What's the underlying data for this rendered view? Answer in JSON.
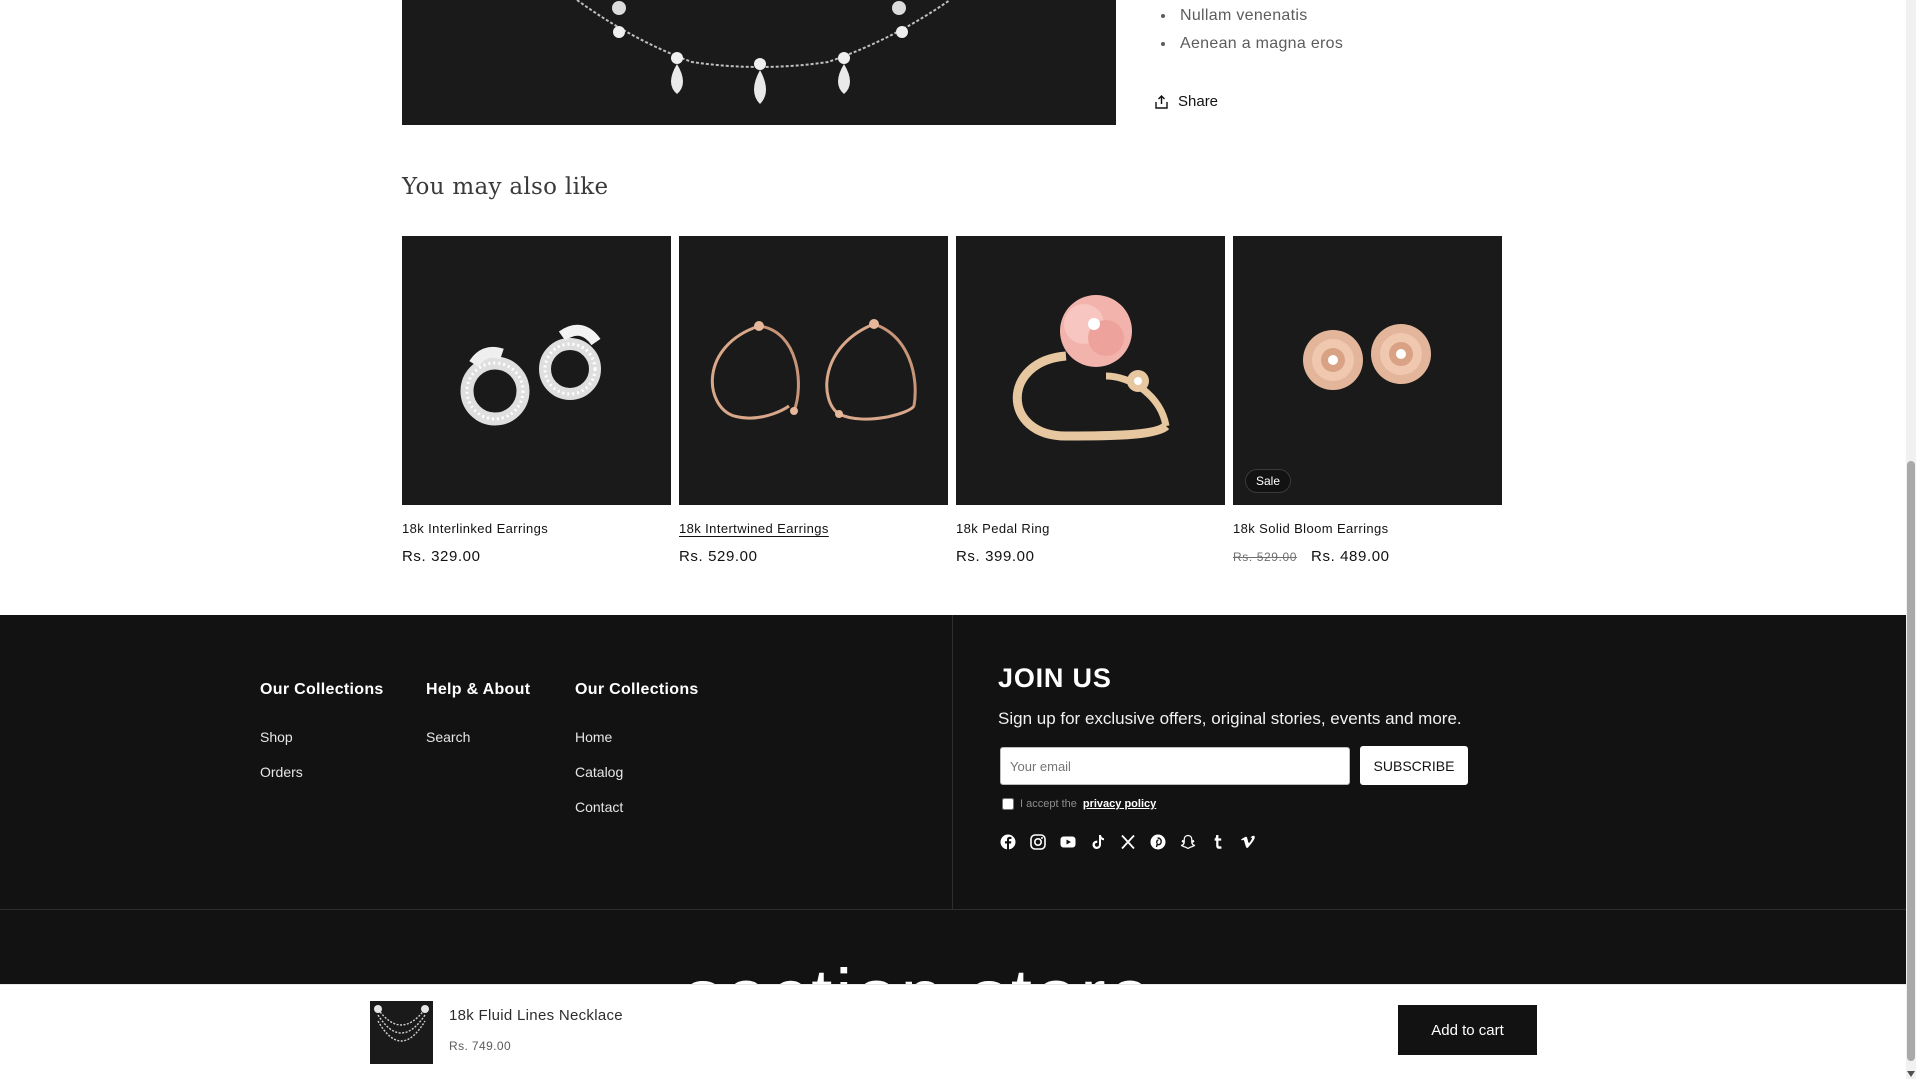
{
  "product": {
    "bullets": [
      "Nullam venenatis",
      "Aenean a magna eros"
    ],
    "share_label": "Share"
  },
  "related": {
    "title": "You may also like",
    "items": [
      {
        "title": "18k Interlinked Earrings",
        "price": "Rs. 329.00",
        "compare_price": "",
        "badge": ""
      },
      {
        "title": "18k Intertwined Earrings",
        "price": "Rs. 529.00",
        "compare_price": "",
        "badge": ""
      },
      {
        "title": "18k Pedal Ring",
        "price": "Rs. 399.00",
        "compare_price": "",
        "badge": ""
      },
      {
        "title": "18k Solid Bloom Earrings",
        "price": "Rs. 489.00",
        "compare_price": "Rs. 529.00",
        "badge": "Sale"
      }
    ]
  },
  "footer": {
    "columns": [
      {
        "heading": "Our Collections",
        "links": [
          "Shop",
          "Orders"
        ]
      },
      {
        "heading": "Help & About",
        "links": [
          "Search"
        ]
      },
      {
        "heading": "Our Collections",
        "links": [
          "Home",
          "Catalog",
          "Contact"
        ]
      }
    ],
    "newsletter": {
      "title": "JOIN US",
      "subtitle": "Sign up for exclusive offers, original stories, events and more.",
      "placeholder": "Your email",
      "button": "SUBSCRIBE",
      "consent_text": "I accept the",
      "consent_link": "privacy policy"
    },
    "socials": [
      "facebook-icon",
      "instagram-icon",
      "youtube-icon",
      "tiktok-icon",
      "x-icon",
      "pinterest-icon",
      "snapchat-icon",
      "tumblr-icon",
      "vimeo-icon"
    ],
    "brand_text": "section store"
  },
  "sticky_bar": {
    "product_name": "18k Fluid Lines Necklace",
    "price": "Rs. 749.00",
    "button": "Add to cart"
  },
  "colors": {
    "dark": "#121212",
    "media_bg": "#1b1a1a",
    "rose_gold": "#e6b79b",
    "silver": "#e8e8e8"
  }
}
